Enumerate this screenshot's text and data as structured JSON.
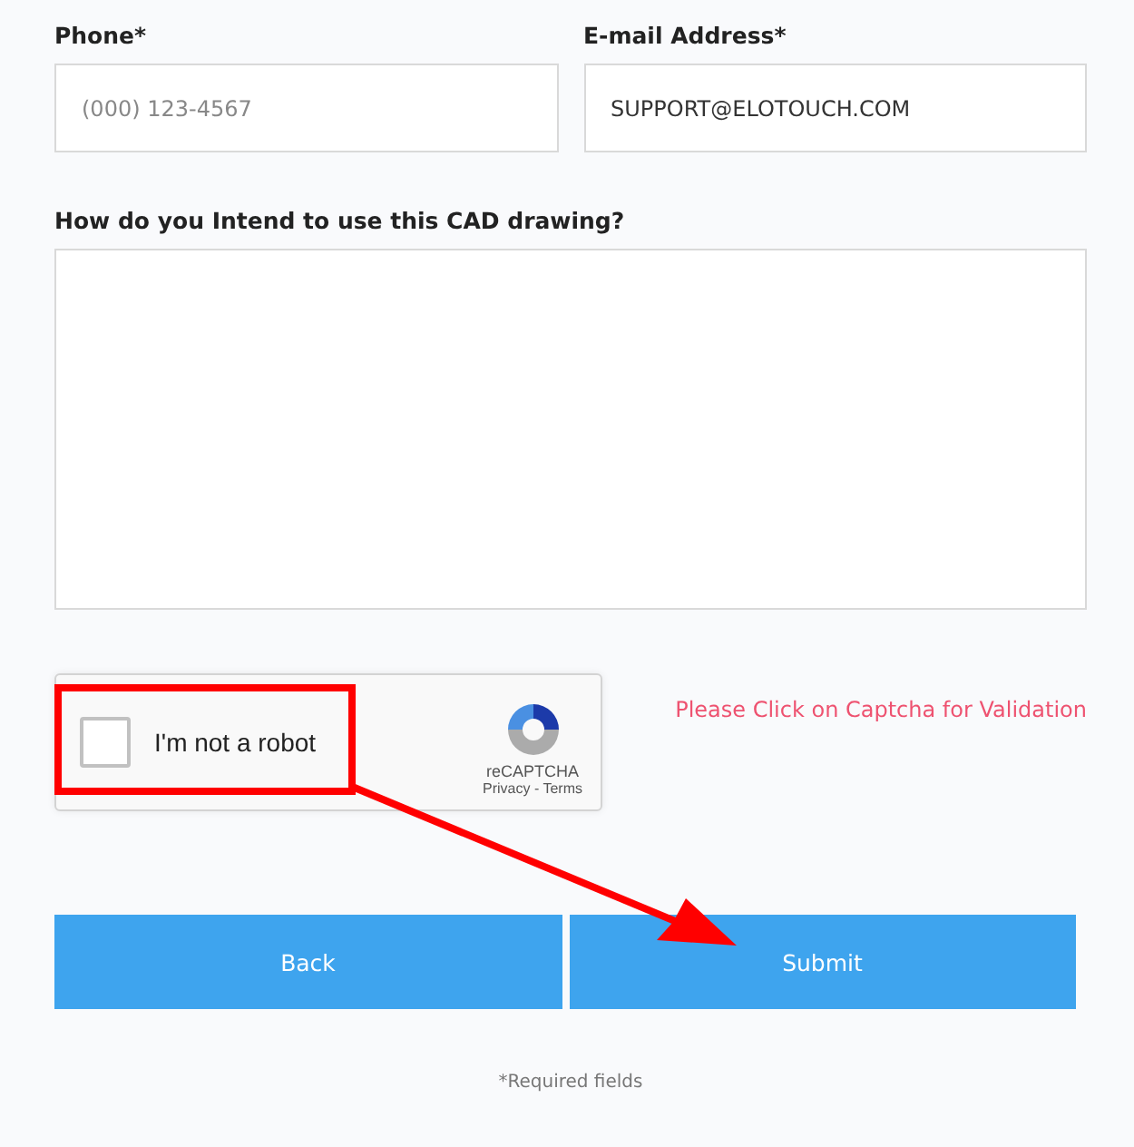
{
  "fields": [
    {
      "label": "Phone*",
      "placeholder": "(000) 123-4567"
    },
    {
      "label": "E-mail Address*",
      "value": "SUPPORT@ELOTOUCH.COM"
    }
  ],
  "question": {
    "label": "How do you Intend to use this CAD drawing?"
  },
  "captcha": {
    "label": "I'm not a robot",
    "checked": false,
    "brand": "reCAPTCHA",
    "links": "Privacy - Terms"
  },
  "validation_message": "Please Click on Captcha for Validation",
  "buttons": [
    "Back",
    "Submit"
  ],
  "footnote": "*Required fields"
}
